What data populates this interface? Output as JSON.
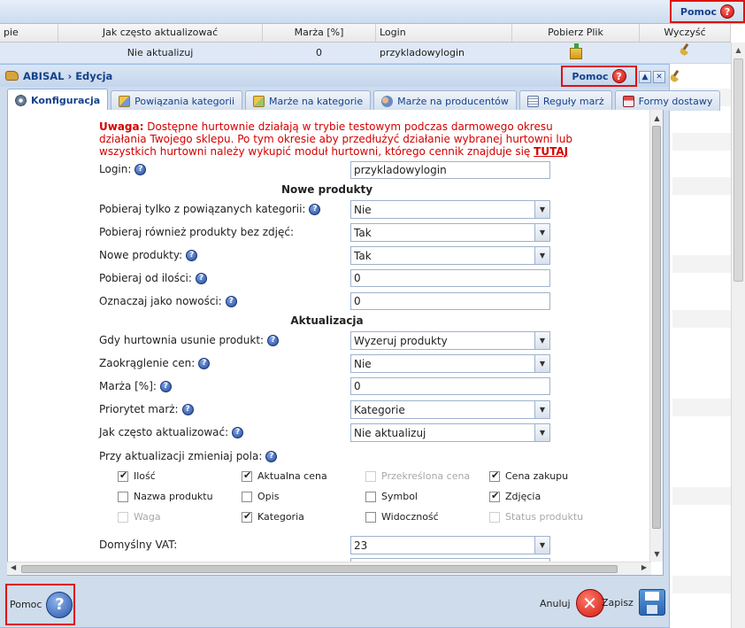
{
  "background": {
    "help_label": "Pomoc",
    "columns": [
      "pie",
      "Jak często aktualizować",
      "Marża [%]",
      "Login",
      "Pobierz Plik",
      "Wyczyść"
    ],
    "row": {
      "frequency": "Nie aktualizuj",
      "margin": "0",
      "login": "przykladowylogin"
    }
  },
  "dialog": {
    "title": "ABISAL › Edycja",
    "help_label": "Pomoc",
    "tabs": [
      {
        "label": "Konfiguracja",
        "icon": "gear-icon",
        "active": true
      },
      {
        "label": "Powiązania kategorii",
        "icon": "category-icon"
      },
      {
        "label": "Marże na kategorie",
        "icon": "margin-category-icon"
      },
      {
        "label": "Marże na producentów",
        "icon": "producers-icon"
      },
      {
        "label": "Reguły marż",
        "icon": "rules-icon"
      },
      {
        "label": "Formy dostawy",
        "icon": "shipping-icon"
      }
    ],
    "warning": {
      "prefix": "Uwaga:",
      "text": "Dostępne hurtownie działają w trybie testowym podczas darmowego okresu działania Twojego sklepu. Po tym okresie aby przedłużyć działanie wybranej hurtowni lub wszystkich hurtowni należy wykupić moduł hurtowni, którego cennik znajduje się",
      "link": "TUTAJ"
    },
    "fields": {
      "login_label": "Login:",
      "login_value": "przykladowylogin",
      "section_new": "Nowe produkty",
      "only_linked_label": "Pobieraj tylko z powiązanych kategorii:",
      "only_linked_value": "Nie",
      "no_images_label": "Pobieraj również produkty bez zdjęć:",
      "no_images_value": "Tak",
      "new_products_label": "Nowe produkty:",
      "new_products_value": "Tak",
      "from_qty_label": "Pobieraj od ilości:",
      "from_qty_value": "0",
      "mark_new_label": "Oznaczaj jako nowości:",
      "mark_new_value": "0",
      "section_update": "Aktualizacja",
      "on_delete_label": "Gdy hurtownia usunie produkt:",
      "on_delete_value": "Wyzeruj produkty",
      "rounding_label": "Zaokrąglenie cen:",
      "rounding_value": "Nie",
      "margin_label": "Marża [%]:",
      "margin_value": "0",
      "priority_label": "Priorytet marż:",
      "priority_value": "Kategorie",
      "frequency_label": "Jak często aktualizować:",
      "frequency_value": "Nie aktualizuj",
      "change_fields_label": "Przy aktualizacji zmieniaj pola:",
      "vat_label": "Domyślny VAT:",
      "vat_value": "23"
    },
    "checkboxes": [
      {
        "label": "Ilość",
        "checked": true,
        "disabled": false
      },
      {
        "label": "Aktualna cena",
        "checked": true,
        "disabled": false
      },
      {
        "label": "Przekreślona cena",
        "checked": false,
        "disabled": true
      },
      {
        "label": "Cena zakupu",
        "checked": true,
        "disabled": false
      },
      {
        "label": "Nazwa produktu",
        "checked": false,
        "disabled": false
      },
      {
        "label": "Opis",
        "checked": false,
        "disabled": false
      },
      {
        "label": "Symbol",
        "checked": false,
        "disabled": false
      },
      {
        "label": "Zdjęcia",
        "checked": true,
        "disabled": false
      },
      {
        "label": "Waga",
        "checked": false,
        "disabled": true
      },
      {
        "label": "Kategoria",
        "checked": true,
        "disabled": false
      },
      {
        "label": "Widoczność",
        "checked": false,
        "disabled": false
      },
      {
        "label": "Status produktu",
        "checked": false,
        "disabled": true
      }
    ],
    "footer": {
      "help_label": "Pomoc",
      "cancel_label": "Anuluj",
      "save_label": "Zapisz"
    }
  }
}
